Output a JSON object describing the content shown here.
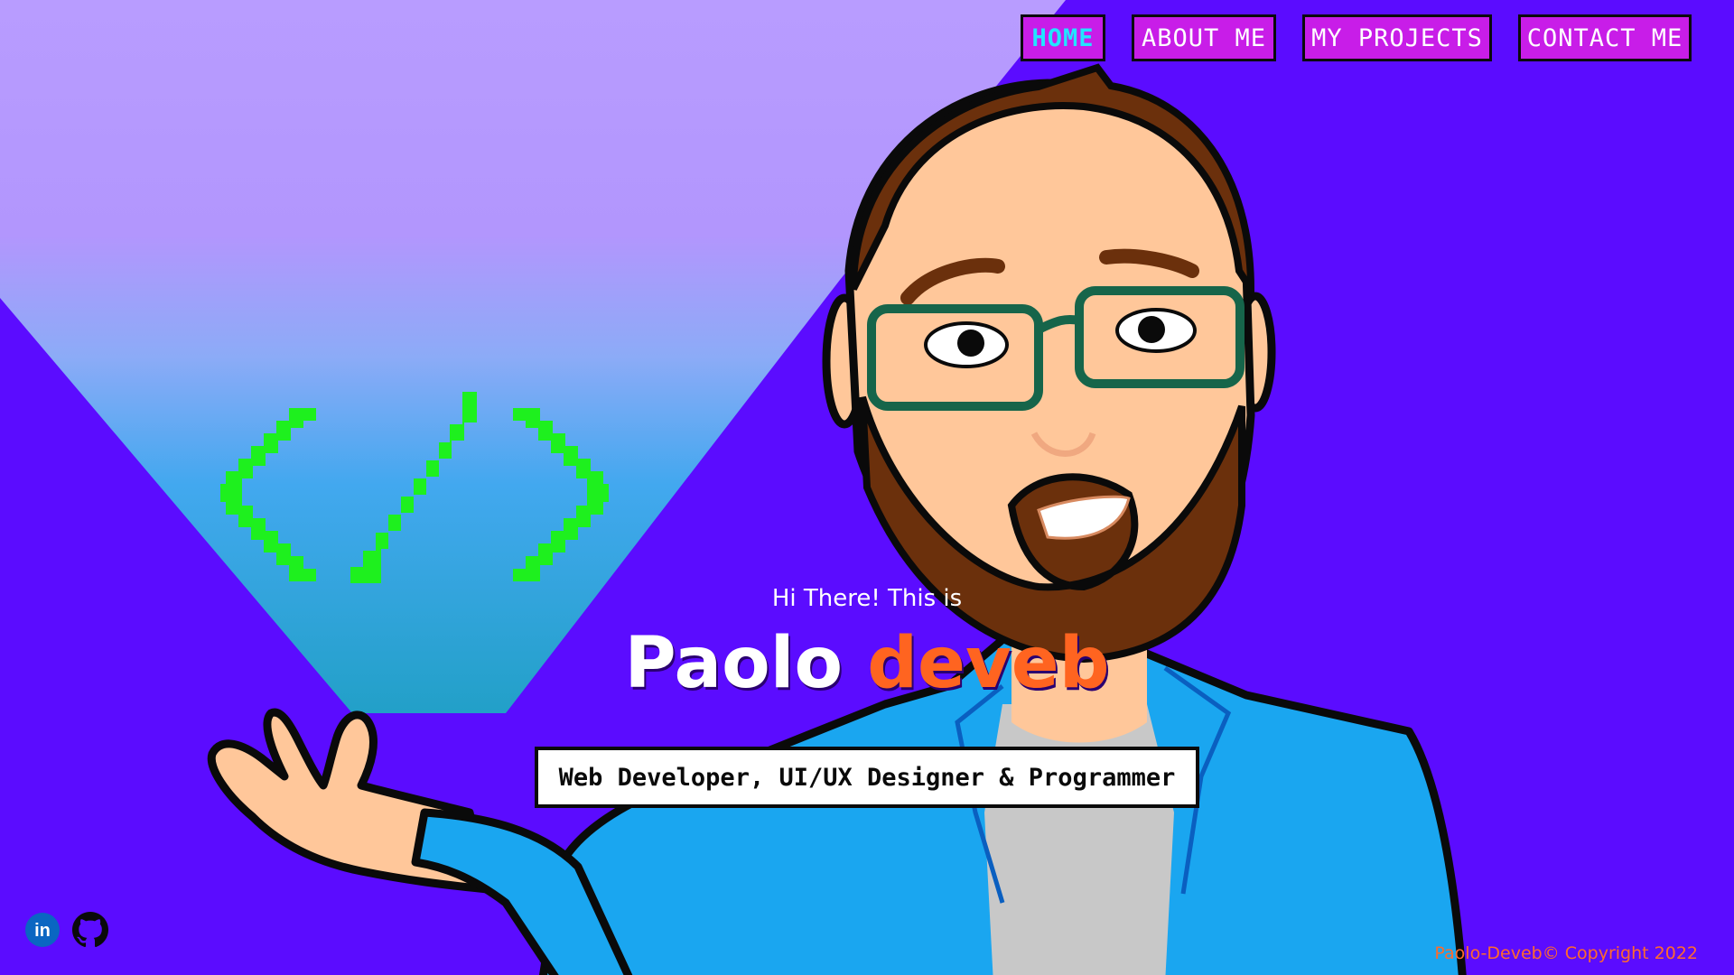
{
  "nav": {
    "items": [
      {
        "label": "HOME",
        "active": true
      },
      {
        "label": "ABOUT ME",
        "active": false
      },
      {
        "label": "MY PROJECTS",
        "active": false
      },
      {
        "label": "CONTACT ME",
        "active": false
      }
    ]
  },
  "hero": {
    "greeting": "Hi There! This is",
    "first_name": "Paolo",
    "last_name": "deveb",
    "tagline": "Web Developer, UI/UX Designer & Programmer"
  },
  "social": {
    "icons": [
      "linkedin-icon",
      "github-icon"
    ],
    "linkedin_glyph": "in"
  },
  "footer": {
    "copyright": "Paolo-Deveb© Copyright 2022"
  },
  "colors": {
    "background": "#5b0cff",
    "nav_bg": "#c81de8",
    "nav_active_text": "#21e5ff",
    "accent_orange": "#ff6420",
    "code_icon_green": "#1ef01e",
    "jacket_blue": "#1aa6f0",
    "linkedin_blue": "#0a66c2"
  }
}
